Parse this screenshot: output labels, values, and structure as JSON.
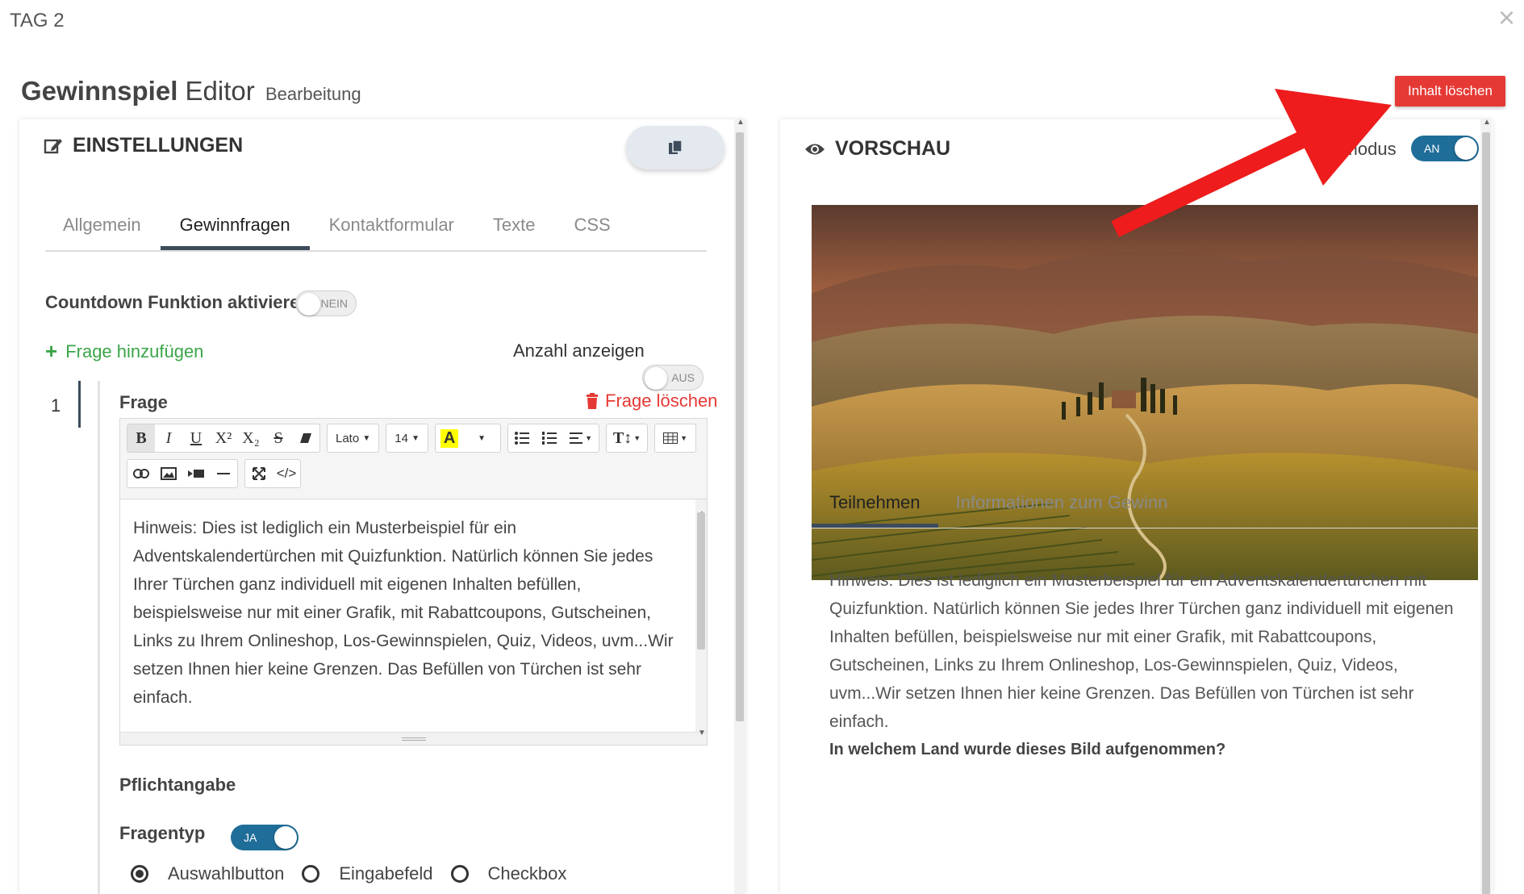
{
  "window": {
    "title": "TAG 2",
    "close_label": "×"
  },
  "header": {
    "title_bold": "Gewinnspiel",
    "title_rest": "Editor",
    "subtitle": "Bearbeitung",
    "clear_button": "Inhalt löschen",
    "clear_button_color": "#e53935"
  },
  "settings": {
    "heading": "EINSTELLUNGEN",
    "tabs": [
      "Allgemein",
      "Gewinnfragen",
      "Kontaktformular",
      "Texte",
      "CSS"
    ],
    "active_tab": "Gewinnfragen",
    "countdown_label": "Countdown Funktion aktivieren",
    "countdown_toggle": "NEIN",
    "add_question": "Frage hinzufügen",
    "show_count_label": "Anzahl anzeigen",
    "show_count_toggle": "AUS",
    "question": {
      "number": "1",
      "label": "Frage",
      "delete_label": "Frage löschen",
      "toolbar": {
        "font": "Lato",
        "font_size": "14",
        "highlight_color": "#ffff00"
      },
      "text": "Hinweis: Dies ist lediglich ein Musterbeispiel für ein Adventskalendertürchen mit Quizfunktion. Natürlich können Sie jedes Ihrer Türchen ganz individuell mit eigenen Inhalten befüllen, beispielsweise nur mit einer Grafik, mit Rabattcoupons, Gutscheinen, Links zu Ihrem Onlineshop, Los-Gewinnspielen, Quiz, Videos, uvm...Wir setzen Ihnen hier keine Grenzen. Das Befüllen von Türchen ist sehr einfach.",
      "required_label": "Pflichtangabe",
      "required_toggle": "JA",
      "type_label": "Fragentyp",
      "types": [
        {
          "label": "Auswahlbutton",
          "checked": true
        },
        {
          "label": "Eingabefeld",
          "checked": false
        },
        {
          "label": "Checkbox",
          "checked": false
        }
      ]
    }
  },
  "preview": {
    "heading": "VORSCHAU",
    "mode_label": "ermodus",
    "mode_toggle": "AN",
    "tabs": [
      "Teilnehmen",
      "Informationen zum Gewinn"
    ],
    "active_tab": "Teilnehmen",
    "text": "Hinweis: Dies ist lediglich ein Musterbeispiel für ein Adventskalendertürchen mit Quizfunktion. Natürlich können Sie jedes Ihrer Türchen ganz individuell mit eigenen Inhalten befüllen, beispielsweise nur mit einer Grafik, mit Rabattcoupons, Gutscheinen, Links zu Ihrem Onlineshop, Los-Gewinnspielen, Quiz, Videos, uvm...Wir setzen Ihnen hier keine Grenzen. Das Befüllen von Türchen ist sehr einfach.",
    "question": "In welchem Land wurde dieses Bild aufgenommen?"
  },
  "colors": {
    "accent_dark": "#3d4b5b",
    "toggle_on": "#1f6e99",
    "link_green": "#3aa548",
    "delete_red": "#e53935",
    "arrow_red": "#ee1c1c"
  }
}
